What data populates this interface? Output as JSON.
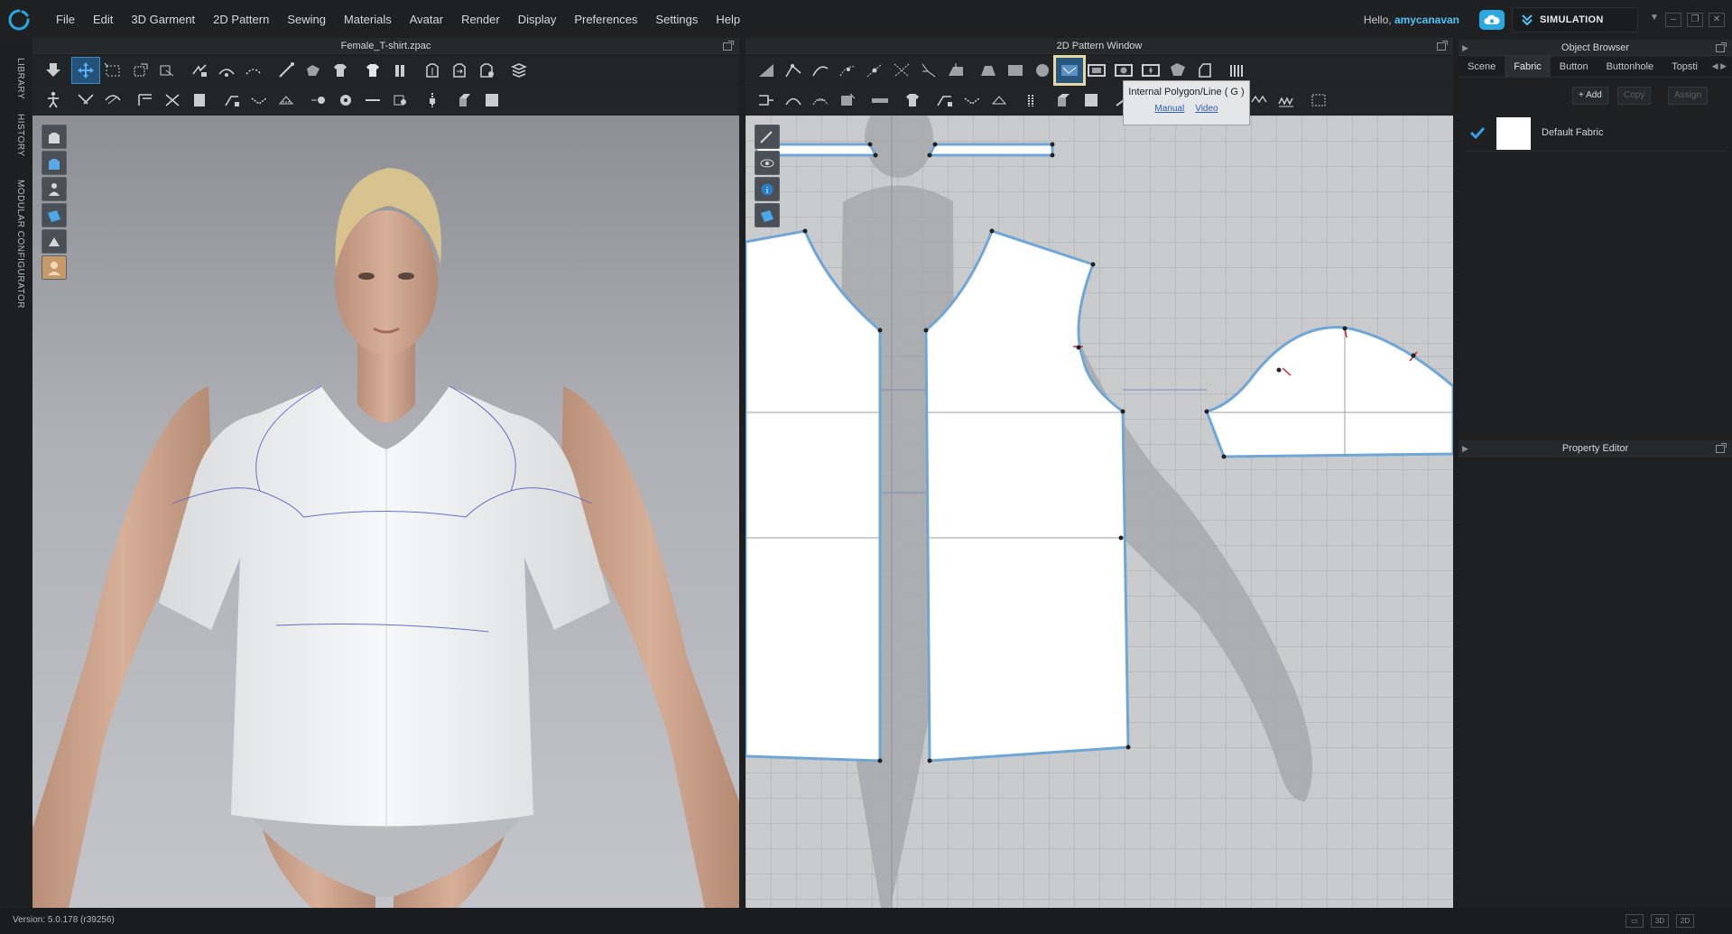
{
  "menu": [
    "File",
    "Edit",
    "3D Garment",
    "2D Pattern",
    "Sewing",
    "Materials",
    "Avatar",
    "Render",
    "Display",
    "Preferences",
    "Settings",
    "Help"
  ],
  "user": {
    "greeting": "Hello,",
    "name": "amycanavan"
  },
  "simulation_label": "SIMULATION",
  "left_tabs": [
    "LIBRARY",
    "HISTORY",
    "MODULAR CONFIGURATOR"
  ],
  "panels": {
    "view3d_title": "Female_T-shirt.zpac",
    "view2d_title": "2D Pattern Window",
    "object_browser_title": "Object Browser",
    "property_editor_title": "Property Editor"
  },
  "tooltip": {
    "title": "Internal Polygon/Line ( G )",
    "manual": "Manual",
    "video": "Video"
  },
  "object_browser": {
    "tabs": [
      "Scene",
      "Fabric",
      "Button",
      "Buttonhole",
      "Topsti"
    ],
    "active_tab": "Fabric",
    "actions": {
      "add": "+ Add",
      "copy": "Copy",
      "assign": "Assign"
    },
    "fabrics": [
      {
        "name": "Default Fabric",
        "color": "#ffffff"
      }
    ]
  },
  "status": {
    "version": "Version: 5.0.178 (r39256)",
    "view_3d": "3D",
    "view_2d": "2D"
  },
  "colors": {
    "accent": "#29a9e0",
    "pattern_outline": "#6fa6d8",
    "user_name": "#4fc3f7"
  }
}
